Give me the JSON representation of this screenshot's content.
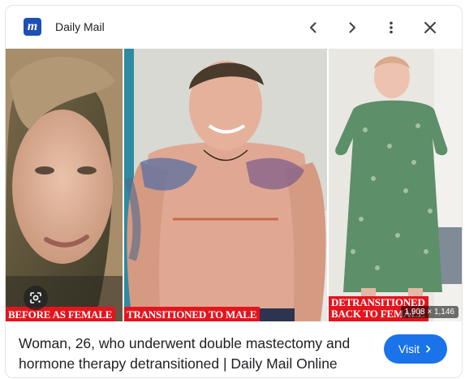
{
  "source": {
    "logo_letter": "m",
    "name": "Daily Mail",
    "brand_color": "#1d4fb5"
  },
  "header_icons": [
    "chevron-left-icon",
    "chevron-right-icon",
    "more-vert-icon",
    "close-icon"
  ],
  "image": {
    "panels": [
      {
        "caption": "BEFORE AS FEMALE"
      },
      {
        "caption": "TRANSITIONED TO MALE"
      },
      {
        "caption_line1": "DETRANSITIONED",
        "caption_line2": "BACK TO FEMALE"
      }
    ],
    "caption_color": "#e4141d",
    "dimensions": "1,908 × 1,146"
  },
  "result": {
    "title": "Woman, 26, who underwent double mastectomy and hormone therapy detransitioned | Daily Mail Online",
    "visit_label": "Visit",
    "visit_color": "#1a73e8"
  }
}
